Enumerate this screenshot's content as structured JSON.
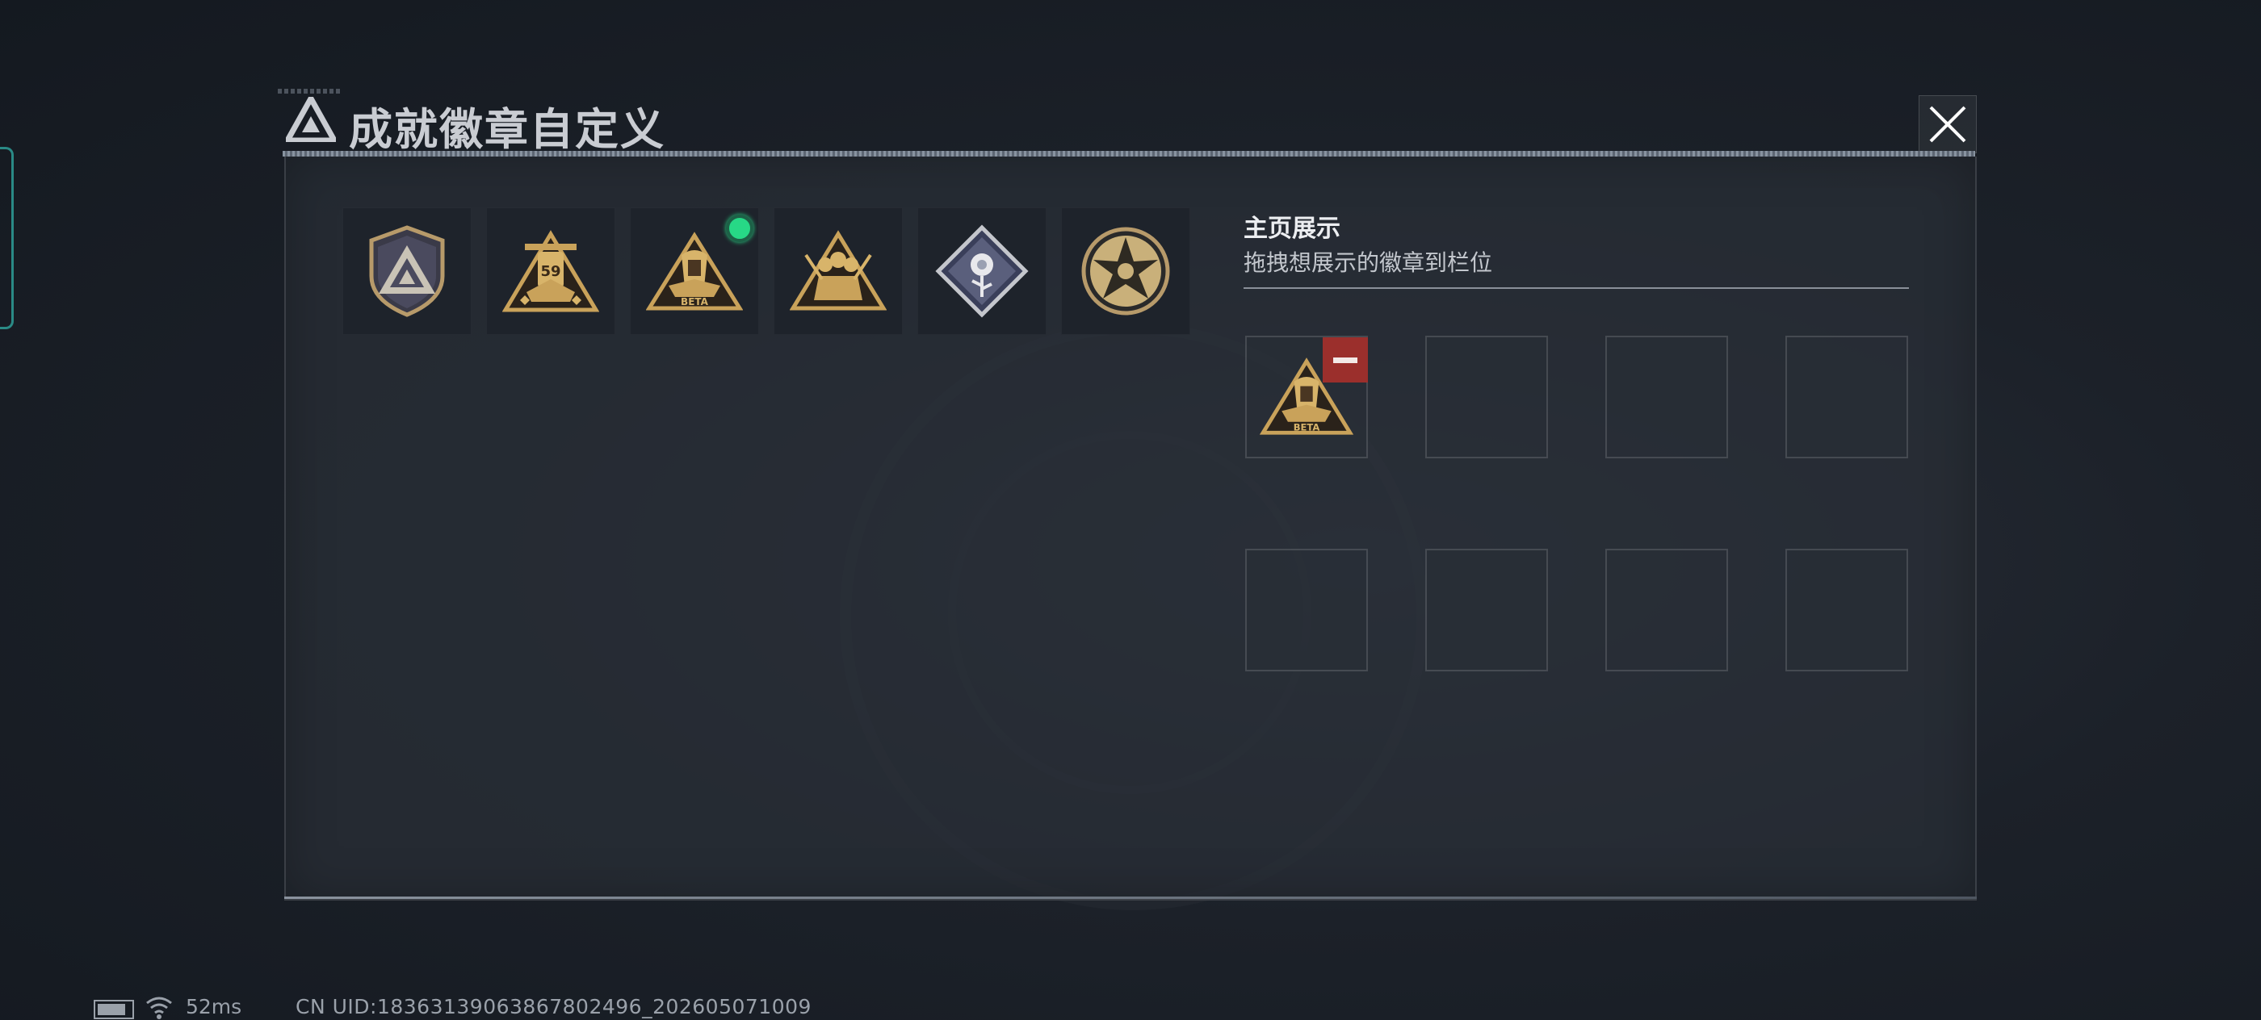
{
  "window": {
    "title": "成就徽章自定义",
    "close_icon": "close-icon"
  },
  "inventory": {
    "badges": [
      {
        "name": "shield-triangle-badge",
        "equipped": false
      },
      {
        "name": "gold-59-emblem-badge",
        "equipped": false
      },
      {
        "name": "beta-emblem-badge",
        "equipped": true
      },
      {
        "name": "squad-triangle-badge",
        "equipped": false
      },
      {
        "name": "rose-diamond-badge",
        "equipped": false
      },
      {
        "name": "star-skull-medal-badge",
        "equipped": false
      }
    ]
  },
  "showcase": {
    "title": "主页展示",
    "subtitle": "拖拽想展示的徽章到栏位",
    "slots": [
      {
        "badge": "beta-emblem-badge",
        "removable": true
      },
      {
        "badge": null
      },
      {
        "badge": null
      },
      {
        "badge": null
      },
      {
        "badge": null
      },
      {
        "badge": null
      },
      {
        "badge": null
      },
      {
        "badge": null
      }
    ]
  },
  "status_bar": {
    "ping": "52ms",
    "uid": "CN UID:18363139063867802496_202605071009"
  },
  "colors": {
    "equipped_dot": "#27d886",
    "remove_button": "#9b2f2c",
    "gold": "#c9a25a"
  }
}
